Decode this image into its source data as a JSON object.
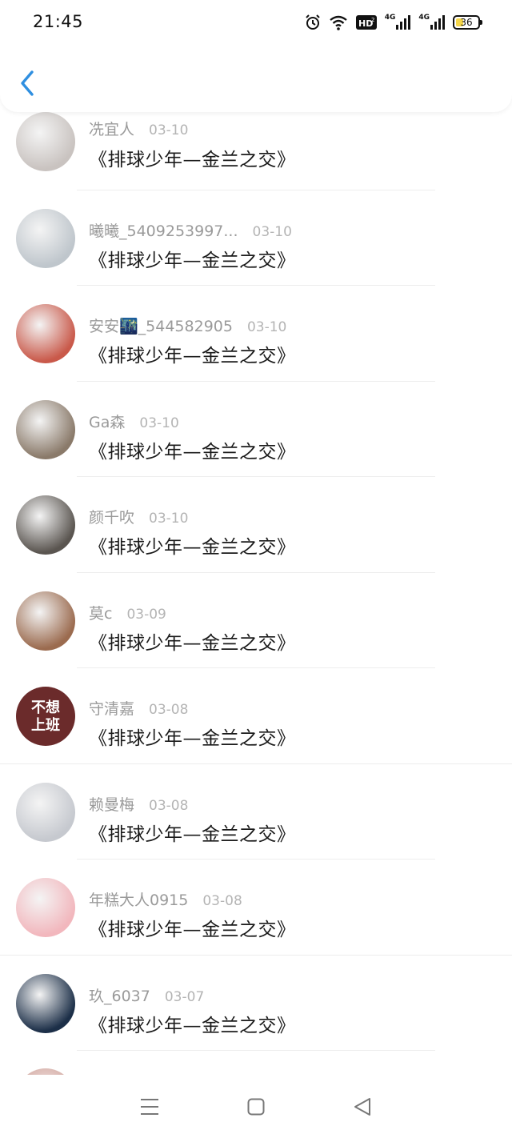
{
  "status_bar": {
    "time": "21:45",
    "network_1": "4G",
    "network_2": "4G",
    "hd_label": "HD",
    "battery_level": "36"
  },
  "header": {
    "back_icon": "chevron-left-icon",
    "accent_color": "#2f8fe0"
  },
  "list": {
    "items": [
      {
        "name": "冼宜人",
        "date": "03-10",
        "comment": "《排球少年—金兰之交》",
        "avatar_color": "#c9c3c0"
      },
      {
        "name": "曦曦_5409253997...",
        "date": "03-10",
        "comment": "《排球少年—金兰之交》",
        "avatar_color": "#bfc6cc"
      },
      {
        "name": "安安🌃_544582905",
        "date": "03-10",
        "comment": "《排球少年—金兰之交》",
        "avatar_color": "#c9594a"
      },
      {
        "name": "Ga森",
        "date": "03-10",
        "comment": "《排球少年—金兰之交》",
        "avatar_color": "#8a7a6a"
      },
      {
        "name": "颜千吹",
        "date": "03-10",
        "comment": "《排球少年—金兰之交》",
        "avatar_color": "#5a5550"
      },
      {
        "name": "莫c",
        "date": "03-09",
        "comment": "《排球少年—金兰之交》",
        "avatar_color": "#9b6b4f"
      },
      {
        "name": "守清嘉",
        "date": "03-08",
        "comment": "《排球少年—金兰之交》",
        "avatar_color": "#6b2b2b",
        "avatar_text": "不想上班"
      },
      {
        "name": "赖曼梅",
        "date": "03-08",
        "comment": "《排球少年—金兰之交》",
        "avatar_color": "#c6c9cf"
      },
      {
        "name": "年糕大人0915",
        "date": "03-08",
        "comment": "《排球少年—金兰之交》",
        "avatar_color": "#f2b7bd"
      },
      {
        "name": "玖_6037",
        "date": "03-07",
        "comment": "《排球少年—金兰之交》",
        "avatar_color": "#1c2f48"
      }
    ]
  },
  "nav_bar": {
    "menu_icon": "menu-icon",
    "home_icon": "square-icon",
    "back_icon": "triangle-back-icon"
  }
}
